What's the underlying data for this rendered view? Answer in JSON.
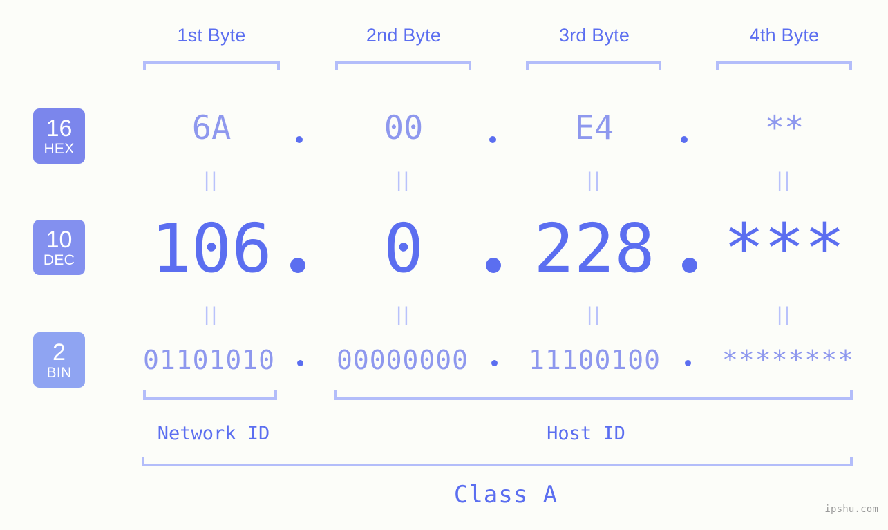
{
  "background_color": "#fcfdf9",
  "accent_colors": {
    "strong_blue": "#5b6ef0",
    "light_blue": "#8e98ee",
    "bracket": "#b3bdfa",
    "equals": "#b9c2fb",
    "badge_hex": "#7b86ec",
    "badge_dec": "#8390ef",
    "badge_bin": "#8fa4f2",
    "watermark": "#9a9a9a"
  },
  "byte_headers": [
    {
      "label": "1st Byte"
    },
    {
      "label": "2nd Byte"
    },
    {
      "label": "3rd Byte"
    },
    {
      "label": "4th Byte"
    }
  ],
  "bases": [
    {
      "number": "16",
      "name": "HEX"
    },
    {
      "number": "10",
      "name": "DEC"
    },
    {
      "number": "2",
      "name": "BIN"
    }
  ],
  "rows": {
    "hex": {
      "base_number": "16",
      "base_name": "HEX",
      "values": [
        "6A",
        "00",
        "E4",
        "**"
      ],
      "separators": [
        ".",
        ".",
        "."
      ]
    },
    "dec": {
      "base_number": "10",
      "base_name": "DEC",
      "values": [
        "106",
        "0",
        "228",
        "***"
      ],
      "separators": [
        ".",
        ".",
        "."
      ]
    },
    "bin": {
      "base_number": "2",
      "base_name": "BIN",
      "values": [
        "01101010",
        "00000000",
        "11100100",
        "********"
      ],
      "separators": [
        ".",
        ".",
        "."
      ]
    }
  },
  "equals_markers": {
    "glyph": "||",
    "count_per_gap": 4,
    "gaps": 2
  },
  "id_sections": [
    {
      "label": "Network ID"
    },
    {
      "label": "Host ID"
    }
  ],
  "class_section": {
    "label": "Class A"
  },
  "watermark": {
    "text": "ipshu.com"
  }
}
